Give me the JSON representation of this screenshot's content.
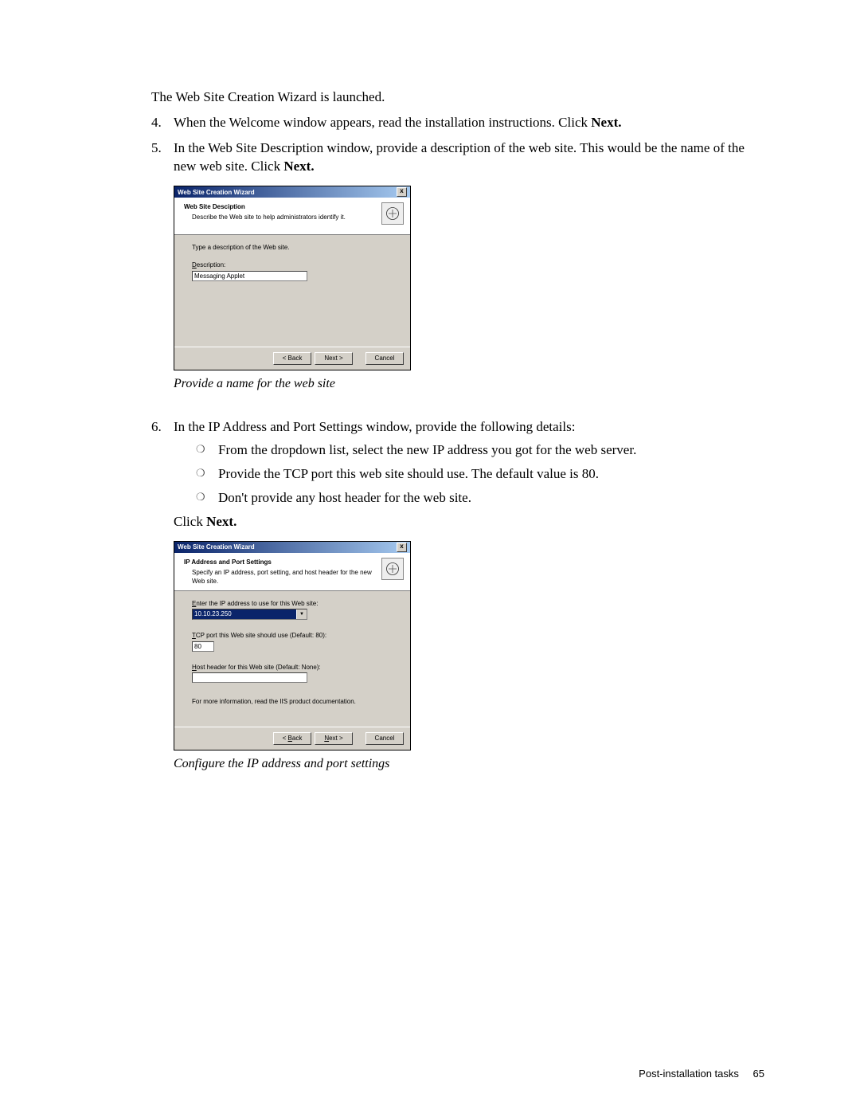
{
  "intro": "The Web Site Creation Wizard is launched.",
  "steps": {
    "s4": {
      "num": "4.",
      "before": "When the Welcome window appears, read the installation instructions. Click ",
      "bold": "Next."
    },
    "s5": {
      "num": "5.",
      "before": "In the Web Site Description window, provide a description of the web site. This would be the name of the new web site. Click ",
      "bold": "Next."
    },
    "s6": {
      "num": "6.",
      "text": "In the IP Address and Port Settings window, provide the following details:",
      "bullets": [
        "From the dropdown list, select the new IP address you got for the web server.",
        "Provide the TCP port this web site should use. The default value is 80.",
        "Don't provide any host header for the web site."
      ],
      "click_before": "Click ",
      "click_bold": "Next."
    }
  },
  "wizard1": {
    "title": "Web Site Creation Wizard",
    "header_title": "Web Site Desciption",
    "header_sub": "Describe the Web site to help administrators identify it.",
    "prompt": "Type a description of the Web site.",
    "desc_label_u": "D",
    "desc_label_rest": "escription:",
    "desc_value": "Messaging Applet",
    "btn_back": "< Back",
    "btn_next": "Next >",
    "btn_cancel": "Cancel",
    "caption": "Provide a name for the web site"
  },
  "wizard2": {
    "title": "Web Site Creation Wizard",
    "header_title": "IP Address and Port Settings",
    "header_sub": "Specify an IP address, port setting, and host header for the new Web site.",
    "ip_label_u": "E",
    "ip_label_rest": "nter the IP address to use for this Web site:",
    "ip_value": "10.10.23.250",
    "tcp_label_u": "T",
    "tcp_label_rest": "CP port this Web site should use (Default: 80):",
    "tcp_value": "80",
    "host_label_u": "H",
    "host_label_rest": "ost header for this Web site (Default: None):",
    "host_value": "",
    "note": "For more information, read the IIS product documentation.",
    "btn_back_u": "B",
    "btn_back_before": "< ",
    "btn_back_after": "ack",
    "btn_next_u": "N",
    "btn_next_after": "ext >",
    "btn_cancel": "Cancel",
    "caption": "Configure the IP address and port settings"
  },
  "footer": {
    "section": "Post-installation tasks",
    "page": "65"
  }
}
